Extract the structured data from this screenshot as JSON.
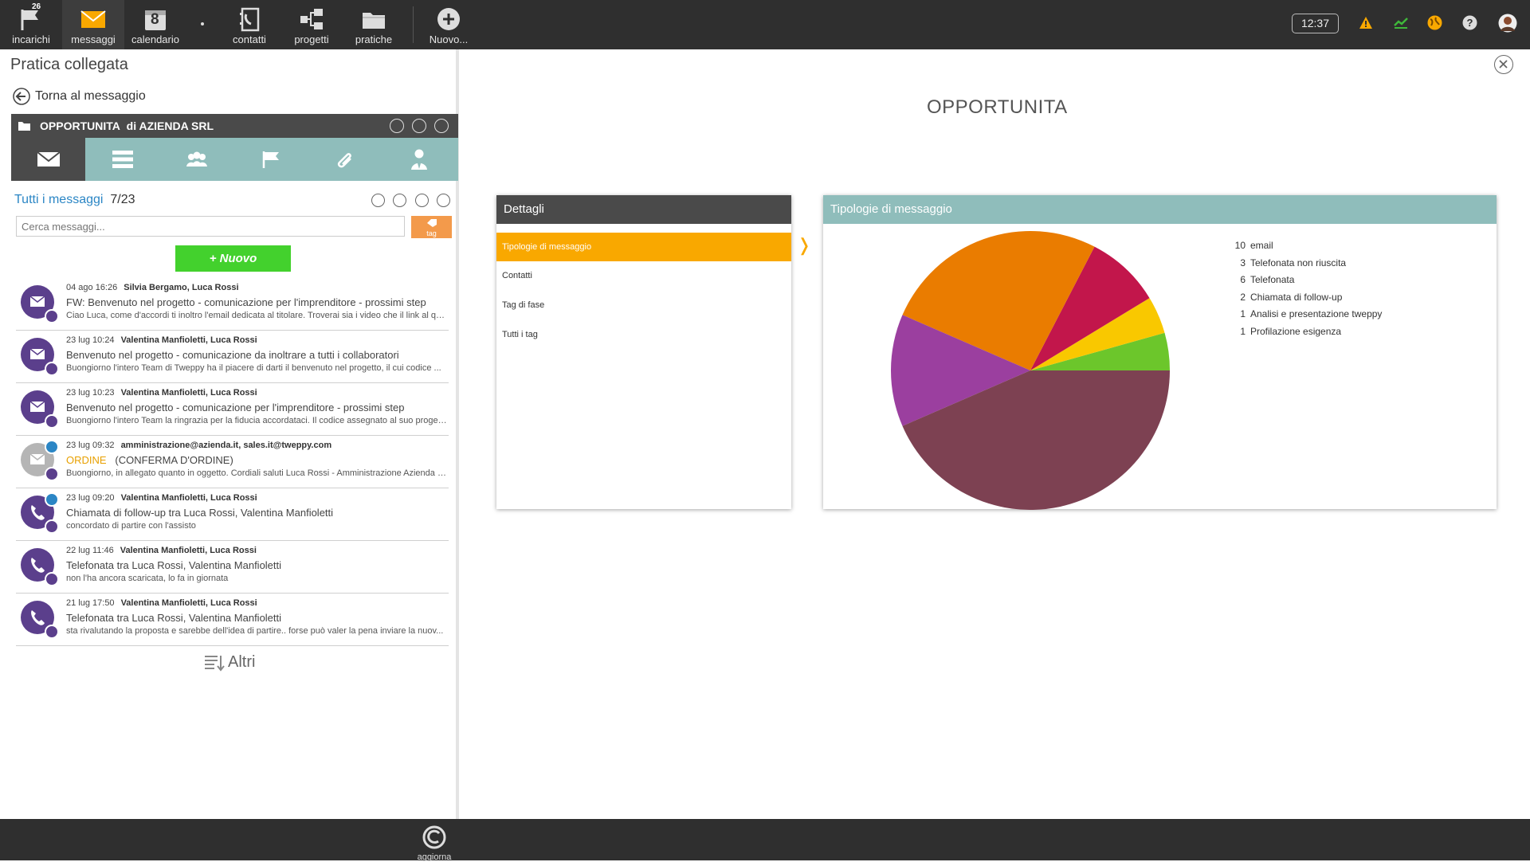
{
  "topbar": {
    "nav": [
      {
        "label": "incarichi",
        "badge": "26"
      },
      {
        "label": "messaggi"
      },
      {
        "label": "calendario",
        "day": "8"
      },
      {
        "label": "contatti"
      },
      {
        "label": "progetti"
      },
      {
        "label": "pratiche"
      },
      {
        "label": "Nuovo..."
      }
    ],
    "clock": "12:37"
  },
  "left": {
    "title": "Pratica collegata",
    "back": "Torna al messaggio",
    "opportunity": {
      "name": "OPPORTUNITA",
      "owner": "di AZIENDA SRL"
    },
    "messages_link": "Tutti i messaggi",
    "messages_count": "7/23",
    "search_placeholder": "Cerca messaggi...",
    "tag_label": "tag",
    "new_label": "+ Nuovo",
    "messages": [
      {
        "date": "04 ago 16:26",
        "people": "Silvia Bergamo, Luca Rossi",
        "subject": "FW: Benvenuto nel progetto - comunicazione per l'imprenditore - prossimi step",
        "preview": "Ciao Luca, come d'accordi ti inoltro l'email dedicata al titolare. Troverai sia i video che il link al qu..."
      },
      {
        "date": "23 lug 10:24",
        "people": "Valentina Manfioletti, Luca Rossi",
        "subject": "Benvenuto nel progetto - comunicazione da inoltrare a tutti i collaboratori",
        "preview": "Buongiorno l'intero Team di Tweppy ha il piacere di darti il benvenuto nel progetto, il cui codice ..."
      },
      {
        "date": "23 lug 10:23",
        "people": "Valentina Manfioletti, Luca Rossi",
        "subject": "Benvenuto nel progetto - comunicazione per l'imprenditore - prossimi step",
        "preview": "Buongiorno l'intero Team la ringrazia per la fiducia accordataci. Il codice assegnato al suo proget..."
      },
      {
        "date": "23 lug 09:32",
        "people": "amministrazione@azienda.it, sales.it@tweppy.com",
        "tag": "ORDINE",
        "subject": "(CONFERMA D'ORDINE)",
        "preview": "Buongiorno, in allegato quanto in oggetto. Cordiali saluti Luca Rossi - Amministrazione Azienda S..."
      },
      {
        "date": "23 lug 09:20",
        "people": "Valentina Manfioletti, Luca Rossi",
        "subject": "Chiamata di follow-up tra Luca Rossi, Valentina Manfioletti",
        "preview": "concordato di partire con l'assisto"
      },
      {
        "date": "22 lug 11:46",
        "people": "Valentina Manfioletti, Luca Rossi",
        "subject": "Telefonata tra Luca Rossi, Valentina Manfioletti",
        "preview": "non l'ha ancora scaricata, lo fa in giornata"
      },
      {
        "date": "21 lug 17:50",
        "people": "Valentina Manfioletti, Luca Rossi",
        "subject": "Telefonata tra Luca Rossi, Valentina Manfioletti",
        "preview": "sta rivalutando la proposta e sarebbe dell'idea di partire.. forse può valer la pena inviare la nuov..."
      }
    ],
    "more": "Altri"
  },
  "main": {
    "title": "OPPORTUNITA",
    "details": {
      "header": "Dettagli",
      "items": [
        "Tipologie di messaggio",
        "Contatti",
        "Tag di fase",
        "Tutti i tag"
      ]
    },
    "chart_panel_title": "Tipologie di messaggio"
  },
  "chart_data": {
    "type": "pie",
    "series": [
      {
        "name": "Profilazione esigenza",
        "value": 1,
        "color": "#6cc62b"
      },
      {
        "name": "Analisi e presentazione tweppy",
        "value": 1,
        "color": "#f9c800"
      },
      {
        "name": "Chiamata di follow-up",
        "value": 2,
        "color": "#c2164b"
      },
      {
        "name": "Telefonata",
        "value": 6,
        "color": "#ea7c00"
      },
      {
        "name": "Telefonata non riuscita",
        "value": 3,
        "color": "#9b3f9f"
      },
      {
        "name": "email",
        "value": 10,
        "color": "#7d4152"
      }
    ]
  },
  "bottom": {
    "refresh": "aggiorna"
  },
  "colors": {
    "accent": "#f9a800",
    "teal": "#8fbdbb",
    "green": "#43d12d",
    "dark": "#2f2f2f"
  }
}
